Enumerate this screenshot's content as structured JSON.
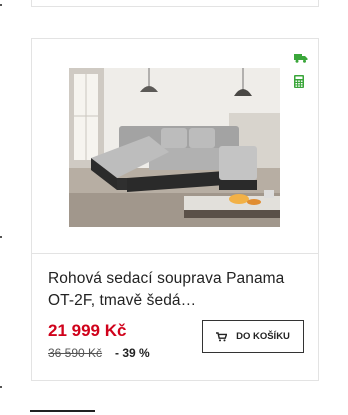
{
  "product": {
    "title": "Rohová sedací souprava Panama OT-2F, tmavě šedá…",
    "price": "21 999 Kč",
    "old_price": "36 590 Kč",
    "discount": "- 39 %",
    "cart_button_label": "DO KOŠÍKU",
    "image_alt": "Corner sofa in a living room",
    "icons": [
      "truck-icon",
      "calculator-icon",
      "cart-icon"
    ]
  },
  "colors": {
    "price": "#d0021b",
    "icon_green": "#3aa63a",
    "border": "#e3e3e3"
  }
}
